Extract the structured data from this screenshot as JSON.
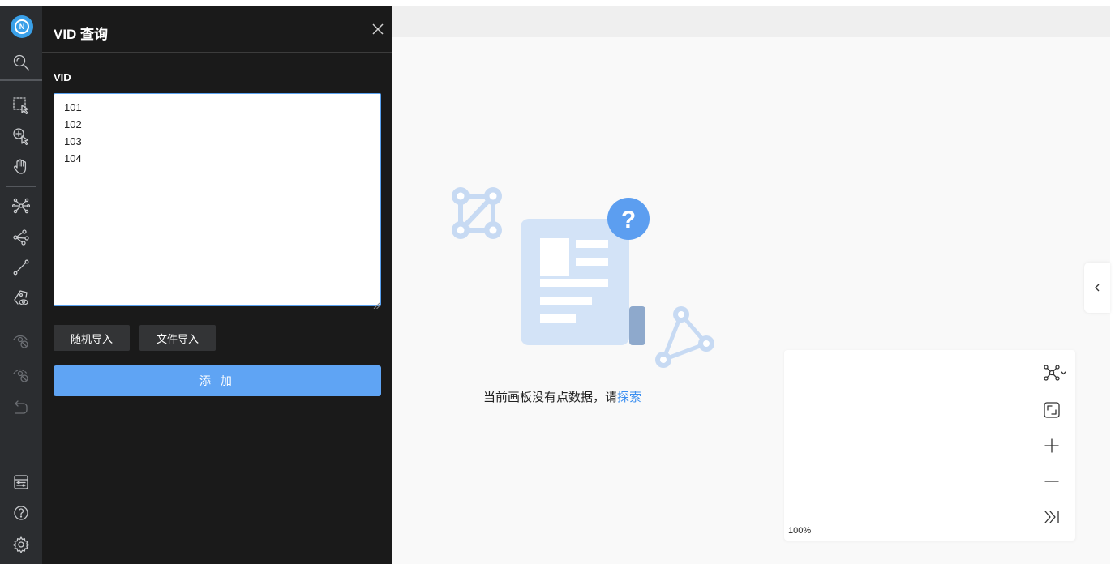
{
  "panel": {
    "title": "VID 查询",
    "field_label": "VID",
    "vid_value": "101\n102\n103\n104",
    "random_import_label": "随机导入",
    "file_import_label": "文件导入",
    "add_label": "添 加"
  },
  "canvas": {
    "empty_text": "当前画板没有点数据，请",
    "explore_link": "探索"
  },
  "minimap": {
    "zoom_level": "100%"
  },
  "toolbar": {
    "icons": [
      "logo-icon",
      "search-icon",
      "select-box-icon",
      "add-node-icon",
      "hand-icon",
      "expand-icon",
      "path-icon",
      "line-icon",
      "tag-view-icon",
      "hide-icon",
      "show-hidden-icon",
      "undo-icon",
      "panel-icon",
      "help-icon",
      "settings-icon"
    ]
  },
  "colors": {
    "accent": "#5fa4f4",
    "panel_bg": "#1a1a1a",
    "toolbar_bg": "#2b2d30",
    "link": "#3a8ef0"
  }
}
